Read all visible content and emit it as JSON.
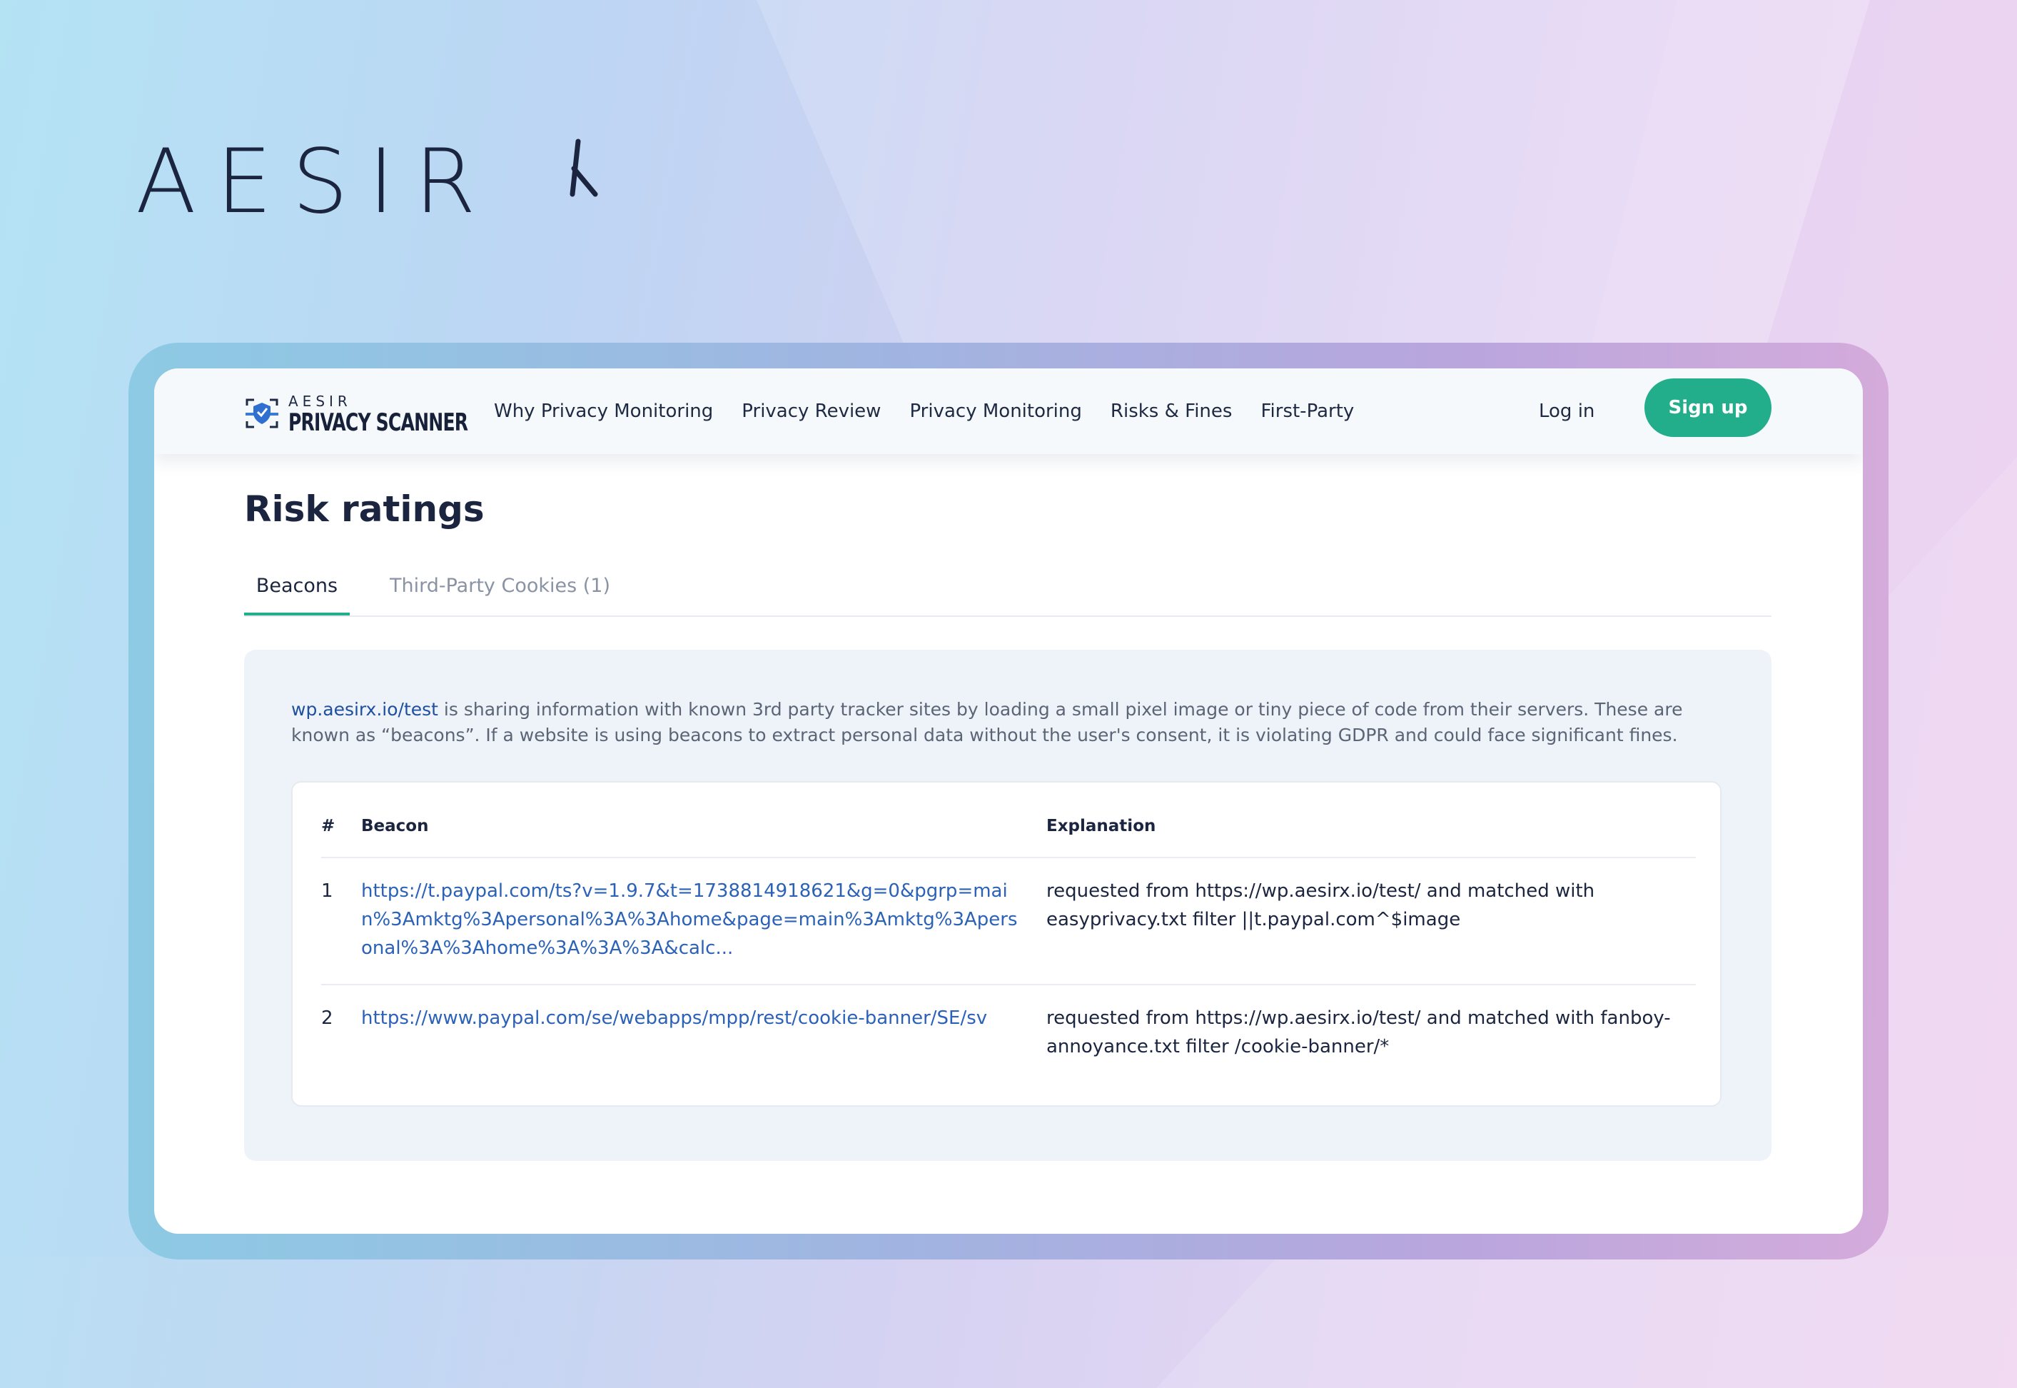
{
  "brand": {
    "wordmark": "AESIR"
  },
  "header": {
    "logo_top": "AESIR",
    "logo_main": "PRIVACY SCANNER",
    "nav": [
      {
        "label": "Why Privacy Monitoring"
      },
      {
        "label": "Privacy Review"
      },
      {
        "label": "Privacy Monitoring"
      },
      {
        "label": "Risks & Fines"
      },
      {
        "label": "First-Party"
      }
    ],
    "login_label": "Log in",
    "signup_label": "Sign up"
  },
  "main": {
    "title": "Risk ratings",
    "tabs": [
      {
        "label": "Beacons",
        "active": true
      },
      {
        "label": "Third-Party Cookies  (1)",
        "active": false
      }
    ],
    "description": {
      "site_link": "wp.aesirx.io/test",
      "text": " is sharing information with known 3rd party tracker sites by loading a small pixel image or tiny piece of code from their servers. These are known as “beacons”. If a website is using beacons to extract personal data without the user's consent, it is violating GDPR and could face significant fines."
    },
    "table": {
      "columns": [
        "#",
        "Beacon",
        "Explanation"
      ],
      "rows": [
        {
          "num": "1",
          "beacon": "https://t.paypal.com/ts?v=1.9.7&t=1738814918621&g=0&pgrp=main%3Amktg%3Apersonal%3A%3Ahome&page=main%3Amktg%3Apersonal%3A%3Ahome%3A%3A%3A&calc...",
          "explanation": "requested from https://wp.aesirx.io/test/ and matched with easyprivacy.txt filter ||t.paypal.com^$image"
        },
        {
          "num": "2",
          "beacon": "https://www.paypal.com/se/webapps/mpp/rest/cookie-banner/SE/sv",
          "explanation": "requested from https://wp.aesirx.io/test/ and matched with fanboy-annoyance.txt filter /cookie-banner/*"
        }
      ]
    }
  },
  "colors": {
    "accent": "#22ad8b",
    "link": "#2b62b8",
    "heading": "#1b2540"
  }
}
